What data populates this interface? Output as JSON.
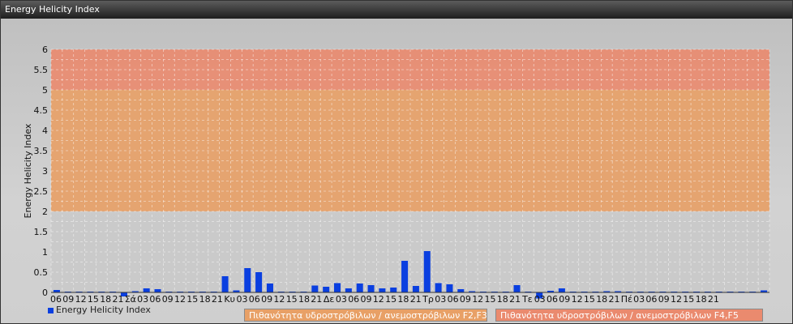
{
  "window": {
    "title": "Energy Helicity Index"
  },
  "chart_data": {
    "type": "bar",
    "ylabel": "Energy Helicity Index",
    "ylim": [
      0,
      6
    ],
    "yticks": [
      0,
      0.5,
      1,
      1.5,
      2,
      2.5,
      3,
      3.5,
      4,
      4.5,
      5,
      5.5,
      6
    ],
    "grid": true,
    "legend_placement": "bottom",
    "x_tick_labels": [
      "06",
      "09",
      "12",
      "15",
      "18",
      "21",
      "Σά",
      "03",
      "06",
      "09",
      "12",
      "15",
      "18",
      "21",
      "Κυ",
      "03",
      "06",
      "09",
      "12",
      "15",
      "18",
      "21",
      "Δε",
      "03",
      "06",
      "09",
      "12",
      "15",
      "18",
      "21",
      "Τρ",
      "03",
      "06",
      "09",
      "12",
      "15",
      "18",
      "21",
      "Τε",
      "03",
      "06",
      "09",
      "12",
      "15",
      "18",
      "21",
      "Πέ",
      "03",
      "06",
      "09",
      "12",
      "15",
      "18",
      "21"
    ],
    "series": [
      {
        "name": "Energy Helicity Index",
        "color": "#0a3fe0",
        "values": [
          0.06,
          0.02,
          0.02,
          0.02,
          0.02,
          0.02,
          -0.1,
          0.03,
          0.1,
          0.08,
          0.02,
          0.02,
          0.02,
          0.02,
          0.02,
          0.4,
          0.05,
          0.6,
          0.5,
          0.22,
          0.02,
          0.02,
          0.02,
          0.17,
          0.14,
          0.23,
          0.1,
          0.22,
          0.18,
          0.1,
          0.12,
          0.78,
          0.16,
          1.02,
          0.23,
          0.2,
          0.08,
          0.03,
          0.02,
          0.02,
          0.02,
          0.18,
          0.02,
          -0.15,
          0.04,
          0.1,
          0.02,
          0.02,
          0.02,
          0.03,
          0.03,
          0.02,
          0.02,
          0.02,
          0.02,
          0.02,
          0.02,
          0.02,
          0.02,
          0.02,
          0.02,
          0.02,
          0.02,
          0.05
        ]
      }
    ],
    "bands": [
      {
        "from": 2,
        "to": 5,
        "label": "Πιθανότητα υδροστρόβιλων / ανεμοστρόβιλων F2,F3",
        "color": "#e8a066"
      },
      {
        "from": 5,
        "to": 6,
        "label": "Πιθανότητα υδροστρόβιλων / ανεμοστρόβιλων F4,F5",
        "color": "#ea8a6e"
      }
    ]
  }
}
